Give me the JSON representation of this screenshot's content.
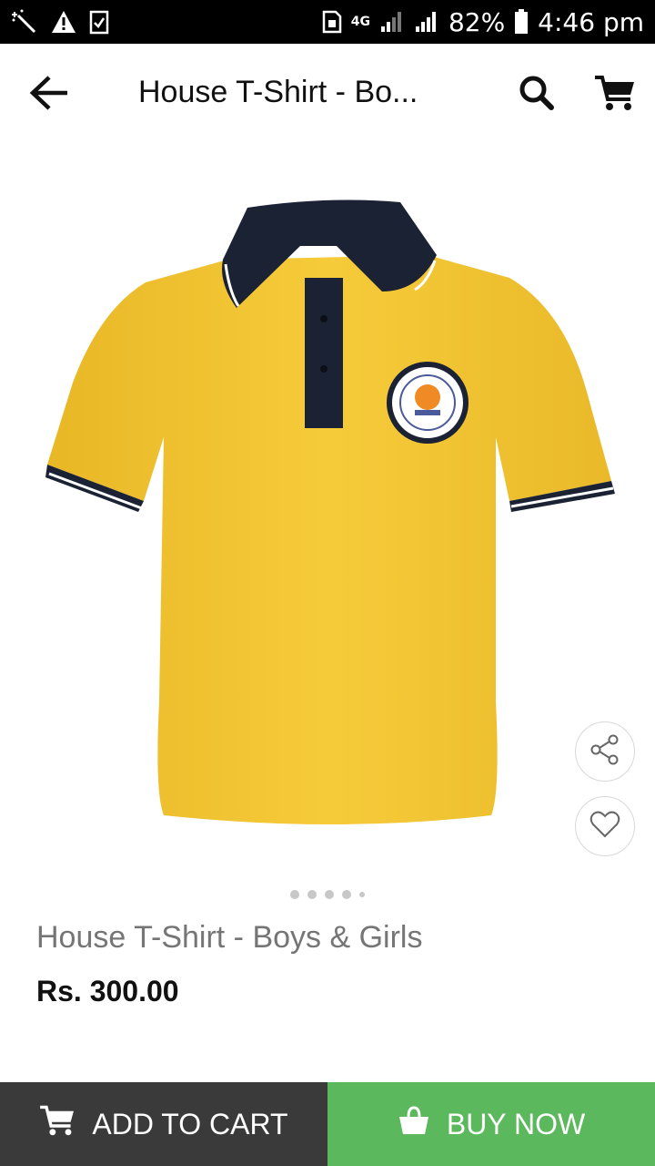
{
  "status_bar": {
    "network": "4G",
    "battery": "82%",
    "time": "4:46 pm"
  },
  "app_bar": {
    "title": "House T-Shirt - Bo..."
  },
  "product": {
    "name": "House T-Shirt - Boys & Girls",
    "price": "Rs. 300.00",
    "image_count": 5,
    "current_image": 1
  },
  "actions": {
    "add_to_cart": "ADD TO CART",
    "buy_now": "BUY NOW"
  },
  "icons": {
    "back": "arrow-left-icon",
    "search": "search-icon",
    "cart": "cart-icon",
    "share": "share-icon",
    "favorite": "heart-icon",
    "buy": "basket-icon"
  },
  "colors": {
    "shirt": "#f4c531",
    "collar": "#1b2233",
    "buy_now_bg": "#5cb85c",
    "add_to_cart_bg": "#3a3a3a"
  }
}
